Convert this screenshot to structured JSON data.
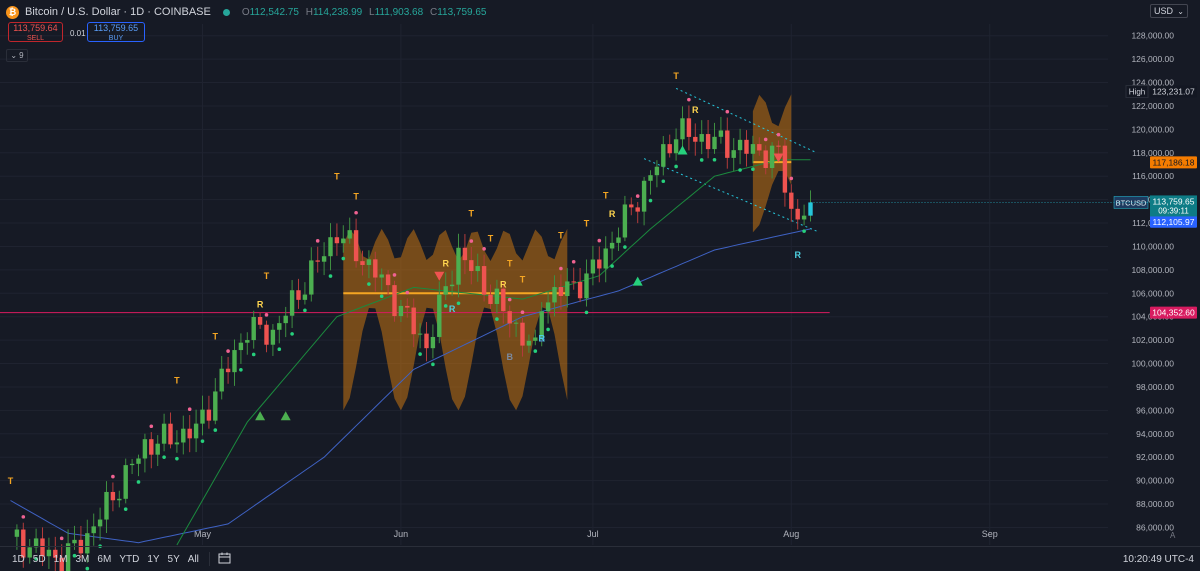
{
  "header": {
    "symbol_title": "Bitcoin / U.S. Dollar · 1D · COINBASE",
    "coin_glyph": "₿",
    "ohlc": [
      {
        "label": "O",
        "value": "112,542.75"
      },
      {
        "label": "H",
        "value": "114,238.99"
      },
      {
        "label": "L",
        "value": "111,903.68"
      },
      {
        "label": "C",
        "value": "113,759.65"
      }
    ]
  },
  "trade": {
    "sell_price": "113,759.64",
    "sell_label": "SELL",
    "spread": "0.01",
    "buy_price": "113,759.65",
    "buy_label": "BUY"
  },
  "indicators_count": "9",
  "currency": "USD",
  "timeframes": [
    "1D",
    "5D",
    "1M",
    "3M",
    "6M",
    "YTD",
    "1Y",
    "5Y",
    "All"
  ],
  "clock": "10:20:49 UTC-4",
  "corner_letter": "A",
  "colors": {
    "up": "#4caf50",
    "down": "#ef5350",
    "cyan": "#26c6da",
    "orange": "#f5a623",
    "background": "#161a25"
  },
  "chart_data": {
    "type": "candlestick",
    "timeframe": "1D",
    "ylim": [
      84500,
      129000
    ],
    "y_ticks": [
      86000,
      88000,
      90000,
      92000,
      94000,
      96000,
      98000,
      100000,
      102000,
      104000,
      106000,
      108000,
      110000,
      112000,
      114000,
      116000,
      118000,
      120000,
      122000,
      124000,
      126000,
      128000
    ],
    "x_labels": [
      {
        "label": "May",
        "date": "2025-05-01"
      },
      {
        "label": "Jun",
        "date": "2025-06-01"
      },
      {
        "label": "Jul",
        "date": "2025-07-01"
      },
      {
        "label": "Aug",
        "date": "2025-08-01"
      },
      {
        "label": "Sep",
        "date": "2025-09-01"
      }
    ],
    "anchor_points": [
      [
        "2025-04-01",
        85200
      ],
      [
        "2025-04-09",
        83200
      ],
      [
        "2025-04-13",
        85300
      ],
      [
        "2025-04-22",
        93000
      ],
      [
        "2025-04-30",
        94300
      ],
      [
        "2025-05-08",
        103000
      ],
      [
        "2025-05-12",
        102600
      ],
      [
        "2025-05-22",
        111200
      ],
      [
        "2025-05-28",
        107800
      ],
      [
        "2025-06-05",
        101500
      ],
      [
        "2025-06-10",
        109500
      ],
      [
        "2025-06-17",
        104500
      ],
      [
        "2025-06-22",
        101000
      ],
      [
        "2025-06-23",
        105400
      ],
      [
        "2025-06-30",
        107200
      ],
      [
        "2025-07-03",
        109600
      ],
      [
        "2025-07-10",
        116000
      ],
      [
        "2025-07-14",
        119800
      ],
      [
        "2025-07-24",
        118400
      ],
      [
        "2025-07-28",
        118000
      ],
      [
        "2025-07-30",
        117800
      ],
      [
        "2025-08-01",
        113000
      ],
      [
        "2025-08-02",
        112500
      ],
      [
        "2025-08-04",
        113759.65
      ]
    ],
    "ema_fast_anchors": [
      [
        "2025-04-27",
        84500
      ],
      [
        "2025-05-08",
        95000
      ],
      [
        "2025-05-22",
        104000
      ],
      [
        "2025-06-03",
        106500
      ],
      [
        "2025-06-20",
        105500
      ],
      [
        "2025-07-02",
        107500
      ],
      [
        "2025-07-10",
        111500
      ],
      [
        "2025-07-20",
        116000
      ],
      [
        "2025-07-30",
        117400
      ],
      [
        "2025-08-04",
        117400
      ]
    ],
    "ema_slow_anchors": [
      [
        "2025-04-01",
        88300
      ],
      [
        "2025-04-10",
        85500
      ],
      [
        "2025-04-21",
        84700
      ],
      [
        "2025-05-05",
        86300
      ],
      [
        "2025-05-20",
        92000
      ],
      [
        "2025-06-03",
        99500
      ],
      [
        "2025-06-20",
        104000
      ],
      [
        "2025-07-05",
        106200
      ],
      [
        "2025-07-20",
        109700
      ],
      [
        "2025-08-04",
        111500
      ]
    ],
    "horizontal_levels": [
      {
        "label": "High",
        "value": 123231.07,
        "color": "#131722",
        "text_color": "#d1d4dc",
        "line": false
      },
      {
        "label": "",
        "value": 117186.18,
        "color": "#f57c00",
        "text_color": "#131722",
        "line": false
      },
      {
        "label": "",
        "value": 112105.97,
        "color": "#2962ff",
        "text_color": "#ffffff",
        "line": false
      },
      {
        "label": "",
        "value": 104352.6,
        "color": "#d81b60",
        "text_color": "#ffffff",
        "line": true
      }
    ],
    "price_tag": {
      "symbol": "BTCUSD",
      "price": "113,759.65",
      "countdown": "09:39:11",
      "value": 113759.65
    },
    "ranges": [
      {
        "from": "2025-05-23",
        "to": "2025-06-27",
        "center": 106000,
        "band_top": 111500,
        "band_bottom": 96000
      },
      {
        "from": "2025-07-26",
        "to": "2025-08-01",
        "center": 117200,
        "band_top": 123000,
        "band_bottom": 111200
      }
    ],
    "channel": {
      "upper": [
        [
          "2025-07-14",
          123500
        ],
        [
          "2025-08-05",
          118000
        ]
      ],
      "lower": [
        [
          "2025-07-09",
          117500
        ],
        [
          "2025-08-05",
          111300
        ]
      ]
    },
    "signals": [
      {
        "date": "2025-04-01",
        "text": "T",
        "kind": "T"
      },
      {
        "date": "2025-04-27",
        "text": "T",
        "kind": "T"
      },
      {
        "date": "2025-05-03",
        "text": "T",
        "kind": "T"
      },
      {
        "date": "2025-05-11",
        "text": "T",
        "kind": "T"
      },
      {
        "date": "2025-05-10",
        "text": "R",
        "kind": "R"
      },
      {
        "date": "2025-05-22",
        "text": "T",
        "kind": "T"
      },
      {
        "date": "2025-05-25",
        "text": "T",
        "kind": "T"
      },
      {
        "date": "2025-06-08",
        "text": "R",
        "kind": "R"
      },
      {
        "date": "2025-06-09",
        "text": "R",
        "kind": "Rc"
      },
      {
        "date": "2025-06-12",
        "text": "T",
        "kind": "T"
      },
      {
        "date": "2025-06-15",
        "text": "T",
        "kind": "T"
      },
      {
        "date": "2025-06-17",
        "text": "R",
        "kind": "R"
      },
      {
        "date": "2025-06-18",
        "text": "T",
        "kind": "T"
      },
      {
        "date": "2025-06-18",
        "text": "B",
        "kind": "Bg"
      },
      {
        "date": "2025-06-20",
        "text": "T",
        "kind": "T"
      },
      {
        "date": "2025-06-23",
        "text": "B",
        "kind": "B"
      },
      {
        "date": "2025-06-23",
        "text": "R",
        "kind": "Rc"
      },
      {
        "date": "2025-06-26",
        "text": "T",
        "kind": "T"
      },
      {
        "date": "2025-06-30",
        "text": "T",
        "kind": "T"
      },
      {
        "date": "2025-07-03",
        "text": "T",
        "kind": "T"
      },
      {
        "date": "2025-07-04",
        "text": "R",
        "kind": "R"
      },
      {
        "date": "2025-07-14",
        "text": "T",
        "kind": "T"
      },
      {
        "date": "2025-07-17",
        "text": "R",
        "kind": "R"
      },
      {
        "date": "2025-08-02",
        "text": "R",
        "kind": "Rc"
      }
    ],
    "triangles": [
      {
        "date": "2025-05-10",
        "value": 95500,
        "dir": "up",
        "color": "#4caf50"
      },
      {
        "date": "2025-05-14",
        "value": 95500,
        "dir": "up",
        "color": "#4caf50"
      },
      {
        "date": "2025-06-07",
        "value": 107500,
        "dir": "down",
        "color": "#ef5350"
      },
      {
        "date": "2025-07-08",
        "value": 107000,
        "dir": "up",
        "color": "#26d07c"
      },
      {
        "date": "2025-07-15",
        "value": 118200,
        "dir": "up",
        "color": "#26d07c"
      },
      {
        "date": "2025-07-30",
        "value": 117600,
        "dir": "down",
        "color": "#ef5350"
      }
    ]
  }
}
